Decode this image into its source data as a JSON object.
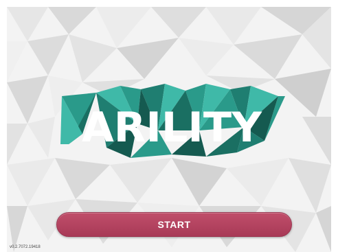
{
  "logo": {
    "text": "ARILITY",
    "colors": {
      "teal_light": "#3fb9a8",
      "teal": "#2a9a8a",
      "teal_dark": "#1a6f62",
      "teal_deep": "#155a50"
    }
  },
  "start_button": {
    "label": "START",
    "color": "#b54562"
  },
  "version": "v0.2.7072.19418",
  "background": {
    "style": "low-poly grey"
  }
}
